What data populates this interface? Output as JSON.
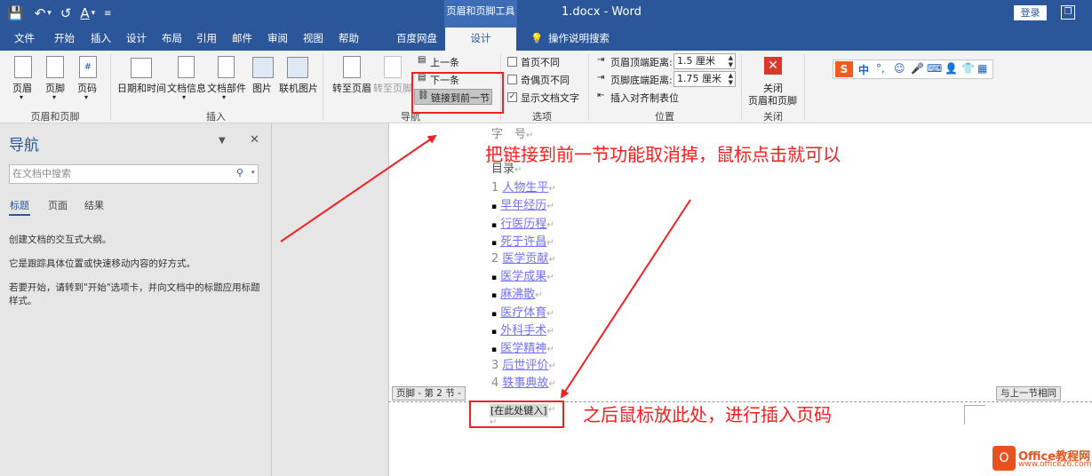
{
  "window": {
    "title": "1.docx - Word",
    "context_tab_group": "页眉和页脚工具",
    "login_label": "登录",
    "restore_symbol": "❐"
  },
  "quick_access": [
    "💾",
    "↶",
    "▾",
    "↺",
    "A",
    "▾",
    "≡"
  ],
  "tabs": [
    "文件",
    "开始",
    "插入",
    "设计",
    "布局",
    "引用",
    "邮件",
    "审阅",
    "视图",
    "帮助",
    "百度网盘",
    "设计"
  ],
  "tell_me": "操作说明搜索",
  "ribbon": {
    "header_footer_group": {
      "label": "页眉和页脚",
      "header": "页眉",
      "footer": "页脚",
      "page_number": "页码"
    },
    "insert_group": {
      "label": "插入",
      "date_time": "日期和时间",
      "doc_info": "文档信息",
      "doc_parts": "文档部件",
      "picture": "图片",
      "online_picture": "联机图片"
    },
    "navigation_group": {
      "label": "导航",
      "goto_header": "转至页眉",
      "goto_footer": "转至页脚",
      "previous": "上一条",
      "next": "下一条",
      "link_to_previous": "链接到前一节"
    },
    "options_group": {
      "label": "选项",
      "different_first_page": "首页不同",
      "different_odd_even": "奇偶页不同",
      "show_document_text": "显示文档文字",
      "show_document_text_checked": true
    },
    "position_group": {
      "label": "位置",
      "header_from_top_label": "页眉顶端距离:",
      "header_from_top_value": "1.5 厘米",
      "footer_from_bottom_label": "页脚底端距离:",
      "footer_from_bottom_value": "1.75 厘米",
      "insert_alignment_tab": "插入对齐制表位"
    },
    "close_group": {
      "label": "关闭",
      "close_line1": "关闭",
      "close_line2": "页眉和页脚"
    }
  },
  "navigation_pane": {
    "title": "导航",
    "search_placeholder": "在文档中搜索",
    "tabs": [
      "标题",
      "页面",
      "结果"
    ],
    "lines": [
      "创建文档的交互式大纲。",
      "它是跟踪具体位置或快速移动内容的好方式。",
      "若要开始，请转到\"开始\"选项卡，并向文档中的标题应用标题",
      "样式。"
    ]
  },
  "document": {
    "top_text": "字　号",
    "toc_heading": "目录",
    "toc": [
      {
        "prefix": "1",
        "text": "人物生平"
      },
      {
        "prefix": "▪",
        "text": "早年经历"
      },
      {
        "prefix": "▪",
        "text": "行医历程"
      },
      {
        "prefix": "▪",
        "text": "死于许昌"
      },
      {
        "prefix": "2",
        "text": "医学贡献"
      },
      {
        "prefix": "▪",
        "text": "医学成果"
      },
      {
        "prefix": "▪",
        "text": "麻沸散"
      },
      {
        "prefix": "▪",
        "text": "医疗体育"
      },
      {
        "prefix": "▪",
        "text": "外科手术"
      },
      {
        "prefix": "▪",
        "text": "医学精神"
      },
      {
        "prefix": "3",
        "text": "后世评价"
      },
      {
        "prefix": "4",
        "text": "轶事典故"
      }
    ],
    "footer_tag": "页脚 - 第 2 节 -",
    "same_as_previous": "与上一节相同",
    "placeholder": "[在此处键入]",
    "paragraph_mark": "↵"
  },
  "annotations": {
    "top": "把链接到前一节功能取消掉，鼠标点击就可以",
    "bottom": "之后鼠标放此处，进行插入页码"
  },
  "watermark": {
    "title": "Office教程网",
    "url": "www.office26.com"
  },
  "colors": {
    "word_blue": "#2b579a",
    "annotation_red": "#ff1a1a",
    "link_color": "#7070ff"
  }
}
